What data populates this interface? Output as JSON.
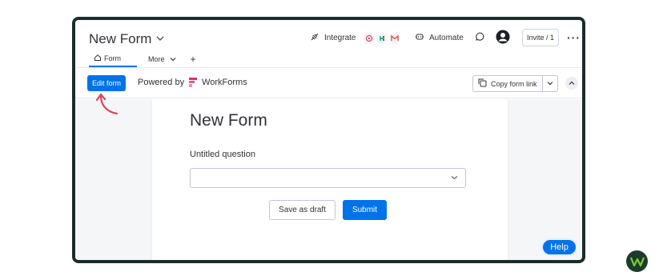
{
  "header": {
    "board_title": "New Form",
    "integrate_label": "Integrate",
    "integrate_apps": [
      "integration-app-1-icon",
      "integration-app-2-icon",
      "gmail-icon"
    ],
    "automate_label": "Automate",
    "invite_label": "Invite / 1"
  },
  "tabs": {
    "form_label": "Form",
    "more_label": "More",
    "add_label": "+"
  },
  "subbar": {
    "edit_form_label": "Edit form",
    "powered_by_label": "Powered by",
    "workforms_label": "WorkForms",
    "copy_link_label": "Copy form link"
  },
  "form": {
    "title": "New Form",
    "question_label": "Untitled question",
    "select_value": "",
    "save_draft_label": "Save as draft",
    "submit_label": "Submit"
  },
  "help": {
    "label": "Help"
  },
  "colors": {
    "primary": "#0073ea",
    "frame_border": "#1c2b2b",
    "annotation_arrow": "#d9445a",
    "brand_bg": "#1d3b2b",
    "brand_accent": "#7ccd2f"
  }
}
